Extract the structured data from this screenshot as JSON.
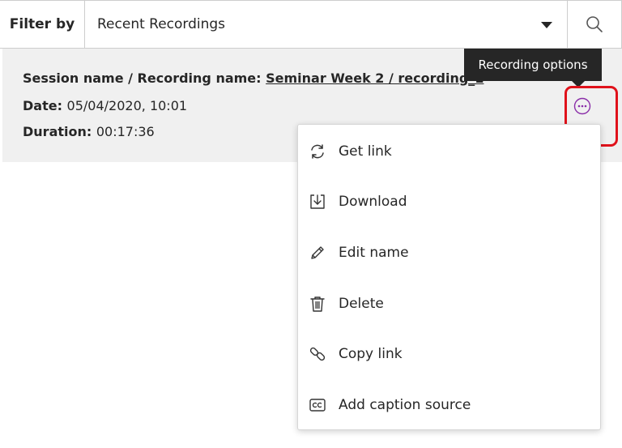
{
  "filter": {
    "label": "Filter by",
    "selected": "Recent Recordings"
  },
  "recording": {
    "session_label": "Session name / Recording name:",
    "session_value": "Seminar Week 2 / recording_1",
    "date_label": "Date:",
    "date_value": "05/04/2020, 10:01",
    "duration_label": "Duration:",
    "duration_value": "00:17:36"
  },
  "tooltip": {
    "text": "Recording options"
  },
  "menu": {
    "items": [
      {
        "label": "Get link",
        "icon": "refresh-icon"
      },
      {
        "label": "Download",
        "icon": "download-icon"
      },
      {
        "label": "Edit name",
        "icon": "pencil-icon"
      },
      {
        "label": "Delete",
        "icon": "trash-icon"
      },
      {
        "label": "Copy link",
        "icon": "chain-link-icon"
      },
      {
        "label": "Add caption source",
        "icon": "closed-caption-icon"
      }
    ]
  },
  "colors": {
    "accent": "#8a2ea8",
    "highlight": "#e0121b",
    "row_background": "#f0f0f0",
    "tooltip_background": "#262626"
  }
}
